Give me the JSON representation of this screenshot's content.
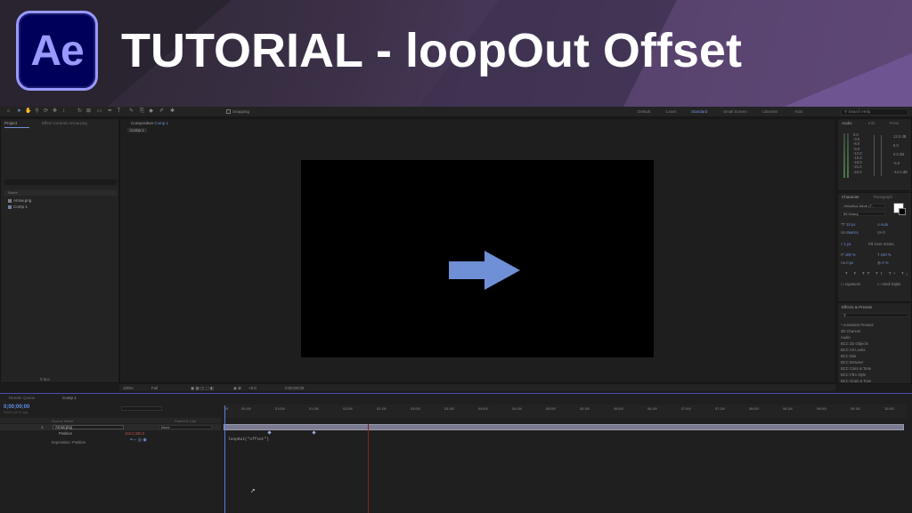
{
  "banner": {
    "logo_text": "Ae",
    "title": "TUTORIAL - loopOut Offset"
  },
  "workspaces": [
    "Default",
    "Learn",
    "Standard",
    "Small Screen",
    "Libraries",
    "Auto"
  ],
  "active_workspace": "Standard",
  "snapping_label": "Snapping",
  "search_help_placeholder": "Search Help",
  "project_panel": {
    "tab_project": "Project",
    "tab_effect_controls": "Effect Controls Arrow.png",
    "column_name": "Name",
    "items": [
      "Arrow.png",
      "Comp 1"
    ],
    "bpc": "8 bpc"
  },
  "composition_panel": {
    "tab": "Composition",
    "comp_name": "Comp 1",
    "sub_tab": "Comp 1",
    "zoom": "100%",
    "resolution": "Full",
    "exposure": "+0.0",
    "time": "0;00;00;00"
  },
  "audio_panel": {
    "tab_audio": "Audio",
    "tab_info": "Info",
    "tab_prev": "Previ",
    "db_left": [
      "0.0",
      "-3.0",
      "-6.0",
      "-9.0",
      "-12.0",
      "-15.0",
      "-18.0",
      "-21.0",
      "-24.0"
    ],
    "db_right": [
      "12.0 dB",
      "6.0",
      "0.0 dB",
      "-6.0",
      "-12.0 dB"
    ]
  },
  "character_panel": {
    "tab_character": "Character",
    "tab_paragraph": "Paragraph",
    "font": "Helvetica Neue (T...",
    "style": "85 Heavy",
    "size": "10 px",
    "leading": "Auto",
    "kerning": "Metrics",
    "tracking": "0",
    "stroke": "1 px",
    "stroke_type": "Fill Over Stroke",
    "vscale": "100 %",
    "hscale": "100 %",
    "baseline": "0 px",
    "tsume": "0 %",
    "ligatures": "Ligatures",
    "hindi_digits": "Hindi Digits"
  },
  "effects_panel": {
    "tab": "Effects & Presets",
    "items": [
      "* Animation Presets",
      "3D Channel",
      "Audio",
      "BCC 3D Objects",
      "BCC Art Looks",
      "BCC Blur",
      "BCC Browser",
      "BCC Color & Tone",
      "BCC Film Style",
      "BCC Grain & Tone"
    ]
  },
  "timeline": {
    "tab_render": "Render Queue",
    "tab_comp": "Comp 1",
    "timecode": "0;00;00;00",
    "timecode_sub": "00000 (29.97 fps)",
    "col_source": "Source Name",
    "col_parent": "Parent & Link",
    "layer_index": "1",
    "layer_name": "Arrow.png",
    "parent_value": "None",
    "property_name": "Position",
    "property_value": "153.0,335.0",
    "expression_label": "Expression: Position",
    "expression": "loopOut(\"offset\")",
    "ticks": [
      "0f",
      "00:15f",
      "01:00f",
      "01:15f",
      "02:00f",
      "02:15f",
      "03:00f",
      "03:15f",
      "04:00f",
      "04:15f",
      "05:00f",
      "05:15f",
      "06:00f",
      "06:15f",
      "07:00f",
      "07:15f",
      "08:00f",
      "08:15f",
      "09:00f",
      "09:15f",
      "10:00f"
    ]
  },
  "colors": {
    "ae_purple": "#9999ff",
    "ae_navy": "#00005b",
    "arrow_fill": "#6f8fd6",
    "timecode_blue": "#5f8fe8",
    "workspace_active": "#6f8fd6"
  }
}
